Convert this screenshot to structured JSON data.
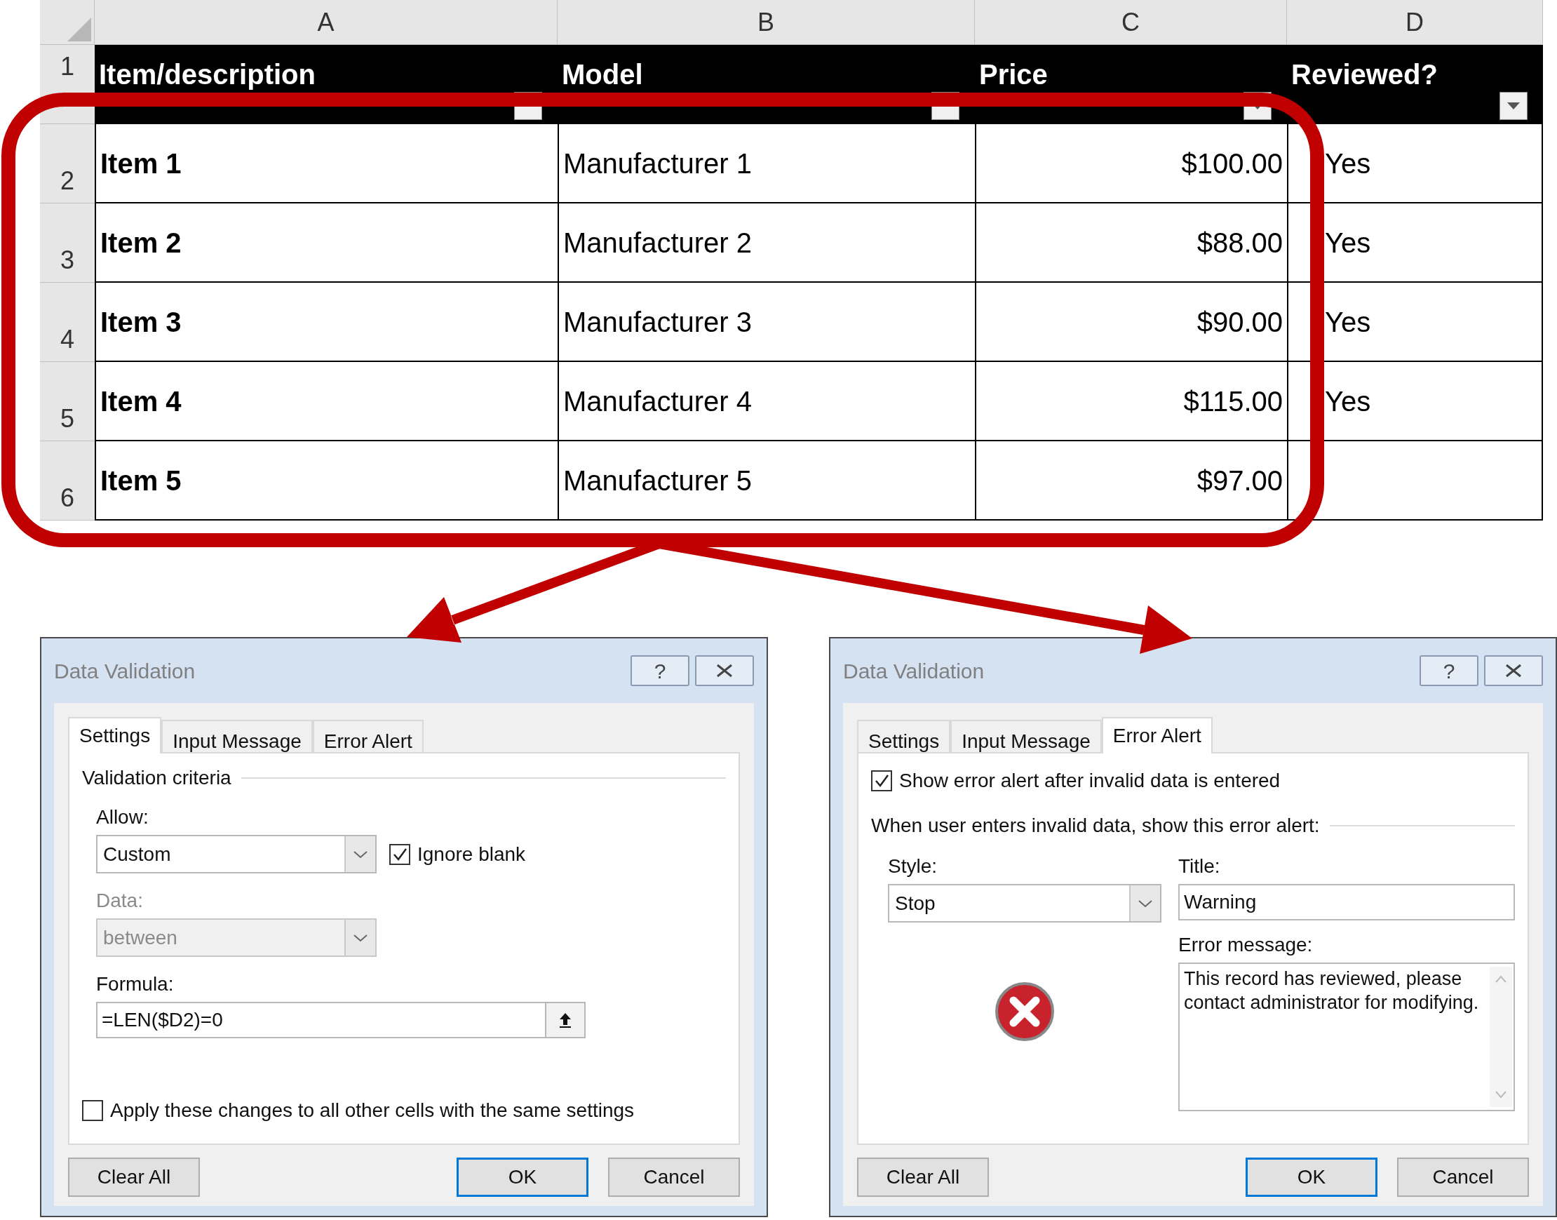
{
  "sheet": {
    "column_headers": [
      "A",
      "B",
      "C",
      "D"
    ],
    "row_numbers": [
      "1",
      "2",
      "3",
      "4",
      "5",
      "6"
    ],
    "columns": [
      {
        "label": "Item/description",
        "filter_arrow": false
      },
      {
        "label": "Model",
        "filter_arrow": false
      },
      {
        "label": "Price",
        "filter_arrow": true
      },
      {
        "label": "Reviewed?",
        "filter_arrow": true
      }
    ],
    "rows": [
      {
        "item": "Item 1",
        "model": "Manufacturer 1",
        "price": "$100.00",
        "reviewed": "Yes"
      },
      {
        "item": "Item 2",
        "model": "Manufacturer 2",
        "price": "$88.00",
        "reviewed": "Yes"
      },
      {
        "item": "Item 3",
        "model": "Manufacturer 3",
        "price": "$90.00",
        "reviewed": "Yes"
      },
      {
        "item": "Item 4",
        "model": "Manufacturer 4",
        "price": "$115.00",
        "reviewed": "Yes"
      },
      {
        "item": "Item 5",
        "model": "Manufacturer 5",
        "price": "$97.00"
      }
    ]
  },
  "dialogs": [
    {
      "kind": "settings",
      "title": "Data Validation",
      "help_glyph": "?",
      "tabs": [
        {
          "label": "Settings",
          "selected": true
        },
        {
          "label": "Input Message",
          "selected": false
        },
        {
          "label": "Error Alert",
          "selected": false
        }
      ],
      "group_label": "Validation criteria",
      "allow": {
        "label": "Allow:",
        "value": "Custom"
      },
      "ignore_blank": {
        "label": "Ignore blank",
        "checked": true
      },
      "data": {
        "label": "Data:",
        "value": "between",
        "disabled": true
      },
      "formula": {
        "label": "Formula:",
        "value": "=LEN($D2)=0"
      },
      "apply_all": {
        "label": "Apply these changes to all other cells with the same settings",
        "checked": false
      },
      "buttons": [
        {
          "label": "Clear All",
          "default": false
        },
        {
          "label": "OK",
          "default": true
        },
        {
          "label": "Cancel",
          "default": false
        }
      ]
    },
    {
      "kind": "error_alert",
      "title": "Data Validation",
      "help_glyph": "?",
      "tabs": [
        {
          "label": "Settings",
          "selected": false
        },
        {
          "label": "Input Message",
          "selected": false
        },
        {
          "label": "Error Alert",
          "selected": true
        }
      ],
      "show_alert": {
        "label": "Show error alert after invalid data is entered",
        "checked": true
      },
      "group_label": "When user enters invalid data, show this error alert:",
      "style": {
        "label": "Style:",
        "value": "Stop"
      },
      "alert_title": {
        "label": "Title:",
        "value": "Warning"
      },
      "message": {
        "label": "Error message:",
        "value": "This record has reviewed, please contact administrator for modifying."
      },
      "buttons": [
        {
          "label": "Clear All",
          "default": false
        },
        {
          "label": "OK",
          "default": true
        },
        {
          "label": "Cancel",
          "default": false
        }
      ]
    }
  ]
}
